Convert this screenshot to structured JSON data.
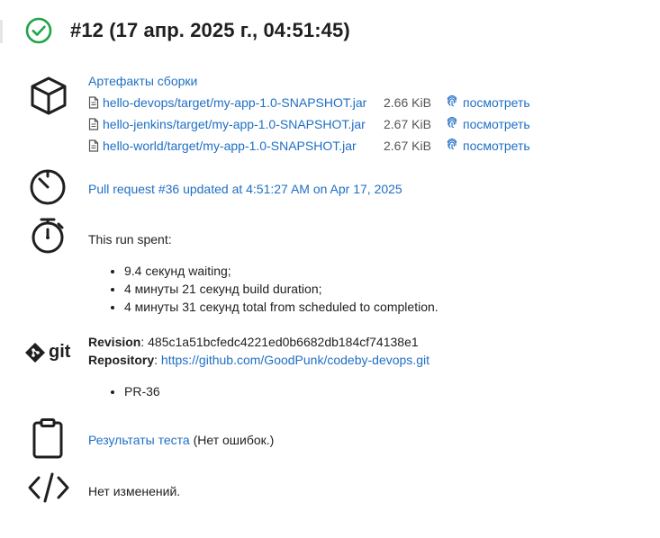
{
  "build": {
    "status": "success",
    "title": "#12 (17 апр. 2025 г., 04:51:45)",
    "status_color": "#1ea446"
  },
  "artifacts": {
    "heading": "Артефакты сборки",
    "view_label": "посмотреть",
    "items": [
      {
        "name": "hello-devops/target/my-app-1.0-SNAPSHOT.jar",
        "size": "2.66 KiB"
      },
      {
        "name": "hello-jenkins/target/my-app-1.0-SNAPSHOT.jar",
        "size": "2.67 KiB"
      },
      {
        "name": "hello-world/target/my-app-1.0-SNAPSHOT.jar",
        "size": "2.67 KiB"
      }
    ]
  },
  "trigger": {
    "text": "Pull request #36 updated at 4:51:27 AM on Apr 17, 2025"
  },
  "timing": {
    "intro": "This run spent:",
    "items": [
      "9.4 секунд waiting;",
      "4 минуты 21 секунд build duration;",
      "4 минуты 31 секунд total from scheduled to completion."
    ]
  },
  "git": {
    "logo_text": "git",
    "revision_label": "Revision",
    "revision_value": ": 485c1a51bcfedc4221ed0b6682db184cf74138e1",
    "repository_label": "Repository",
    "repository_sep": ": ",
    "repository_url": "https://github.com/GoodPunk/codeby-devops.git",
    "branches": [
      "PR-36"
    ]
  },
  "tests": {
    "link": "Результаты теста",
    "suffix": " (Нет ошибок.)"
  },
  "changes": {
    "text": "Нет изменений."
  },
  "colors": {
    "link": "#1f6fc5",
    "text": "#1f1f1f",
    "success": "#1ea446"
  },
  "icons": {
    "status": "check-circle-icon",
    "artifacts": "package-box-icon",
    "trigger": "timer-icon",
    "timing": "stopwatch-icon",
    "git": "git-logo-icon",
    "tests": "clipboard-icon",
    "changes": "code-icon",
    "file": "file-icon",
    "view": "fingerprint-icon"
  }
}
